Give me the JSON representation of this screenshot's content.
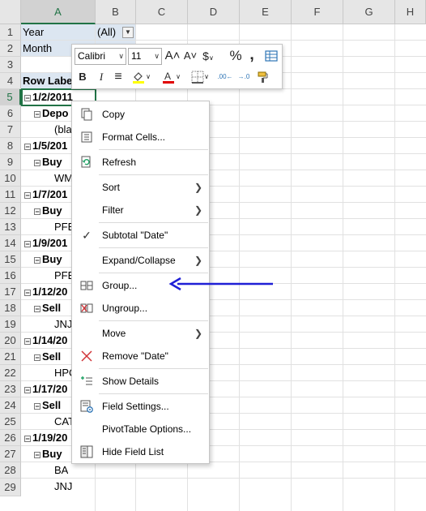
{
  "columns": [
    "A",
    "B",
    "C",
    "D",
    "E",
    "F",
    "G",
    "H"
  ],
  "rows": [
    "1",
    "2",
    "3",
    "4",
    "5",
    "6",
    "7",
    "8",
    "9",
    "10",
    "11",
    "12",
    "13",
    "14",
    "15",
    "16",
    "17",
    "18",
    "19",
    "20",
    "21",
    "22",
    "23",
    "24",
    "25",
    "26",
    "27",
    "28",
    "29"
  ],
  "cells": {
    "r1a": "Year",
    "r1b": "(All)",
    "r2a": "Month",
    "r4a": "Row Labe",
    "r5a": "1/2/2011",
    "r6a": "Depo",
    "r7a": "(bla",
    "r8a": "1/5/201",
    "r9a": "Buy",
    "r10a": "WM",
    "r11a": "1/7/201",
    "r12a": "Buy",
    "r13a": "PFE",
    "r14a": "1/9/201",
    "r15a": "Buy",
    "r16a": "PFE",
    "r17a": "1/12/20",
    "r18a": "Sell",
    "r19a": "JNJ",
    "r20a": "1/14/20",
    "r21a": "Sell",
    "r22a": "HPC",
    "r23a": "1/17/20",
    "r24a": "Sell",
    "r25a": "CAT",
    "r26a": "1/19/20",
    "r27a": "Buy",
    "r28a": "BA",
    "r29a": "JNJ"
  },
  "mini_toolbar": {
    "font": "Calibri",
    "size": "11",
    "grow": "A˄",
    "shrink": "A˅",
    "currency": "$",
    "percent": "%",
    "comma": "‚",
    "bold": "B",
    "italic": "I",
    "align": "≡",
    "increase_decimal": ".00←",
    "decrease_decimal": "→.0"
  },
  "context_menu": {
    "copy": "Copy",
    "format_cells": "Format Cells...",
    "refresh": "Refresh",
    "sort": "Sort",
    "filter": "Filter",
    "subtotal": "Subtotal \"Date\"",
    "expand_collapse": "Expand/Collapse",
    "group": "Group...",
    "ungroup": "Ungroup...",
    "move": "Move",
    "remove": "Remove \"Date\"",
    "show_details": "Show Details",
    "field_settings": "Field Settings...",
    "pivot_options": "PivotTable Options...",
    "hide_field_list": "Hide Field List"
  },
  "colors": {
    "accent_green": "#217346",
    "arrow_blue": "#1f1fd6",
    "band_blue": "#dce6f1"
  }
}
